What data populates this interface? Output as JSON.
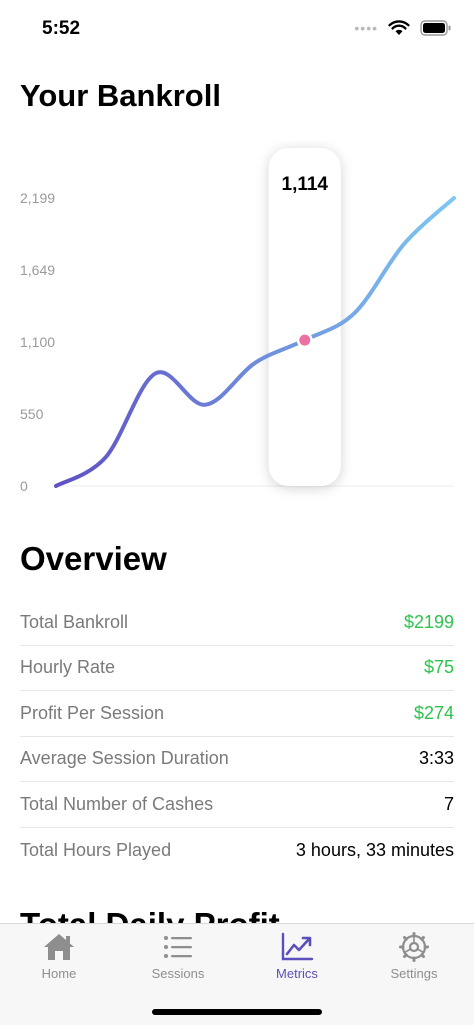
{
  "status_bar": {
    "time": "5:52",
    "dots": "••••"
  },
  "page_title": "Your Bankroll",
  "chart_data": {
    "type": "line",
    "title": "",
    "xlabel": "",
    "ylabel": "",
    "ylim": [
      0,
      2199
    ],
    "y_ticks": [
      0,
      550,
      1100,
      1649,
      2199
    ],
    "y_tick_labels": [
      "0",
      "550",
      "1,100",
      "1,649",
      "2,199"
    ],
    "x": [
      0,
      1,
      2,
      3,
      4,
      5,
      6,
      7,
      8,
      9,
      10,
      11,
      12
    ],
    "values": [
      0,
      220,
      860,
      620,
      940,
      1114,
      1320,
      1850,
      2199
    ],
    "series": [
      {
        "values": [
          0,
          220,
          860,
          620,
          940,
          1114,
          1320,
          1850,
          2199
        ]
      }
    ],
    "highlight": {
      "index": 5,
      "value": 1114,
      "label": "1,114"
    },
    "grid": false,
    "colors": {
      "line_start": "#5f4fc4",
      "line_end": "#7ec8f2",
      "marker": "#ec6fa6"
    }
  },
  "overview": {
    "title": "Overview",
    "rows": [
      {
        "label": "Total Bankroll",
        "value": "$2199"
      },
      {
        "label": "Hourly Rate",
        "value": "$75"
      },
      {
        "label": "Profit Per Session",
        "value": "$274"
      },
      {
        "label": "Average Session Duration",
        "value": "3:33"
      },
      {
        "label": "Total Number of Cashes",
        "value": "7"
      },
      {
        "label": "Total Hours Played",
        "value": "3 hours, 33 minutes"
      }
    ],
    "positive_color": "#2ec34f"
  },
  "next_section_title": "Total Daily Profit",
  "tabs": [
    {
      "label": "Home",
      "icon": "home-icon",
      "active": false
    },
    {
      "label": "Sessions",
      "icon": "list-icon",
      "active": false
    },
    {
      "label": "Metrics",
      "icon": "chart-icon",
      "active": true
    },
    {
      "label": "Settings",
      "icon": "gear-icon",
      "active": false
    }
  ]
}
